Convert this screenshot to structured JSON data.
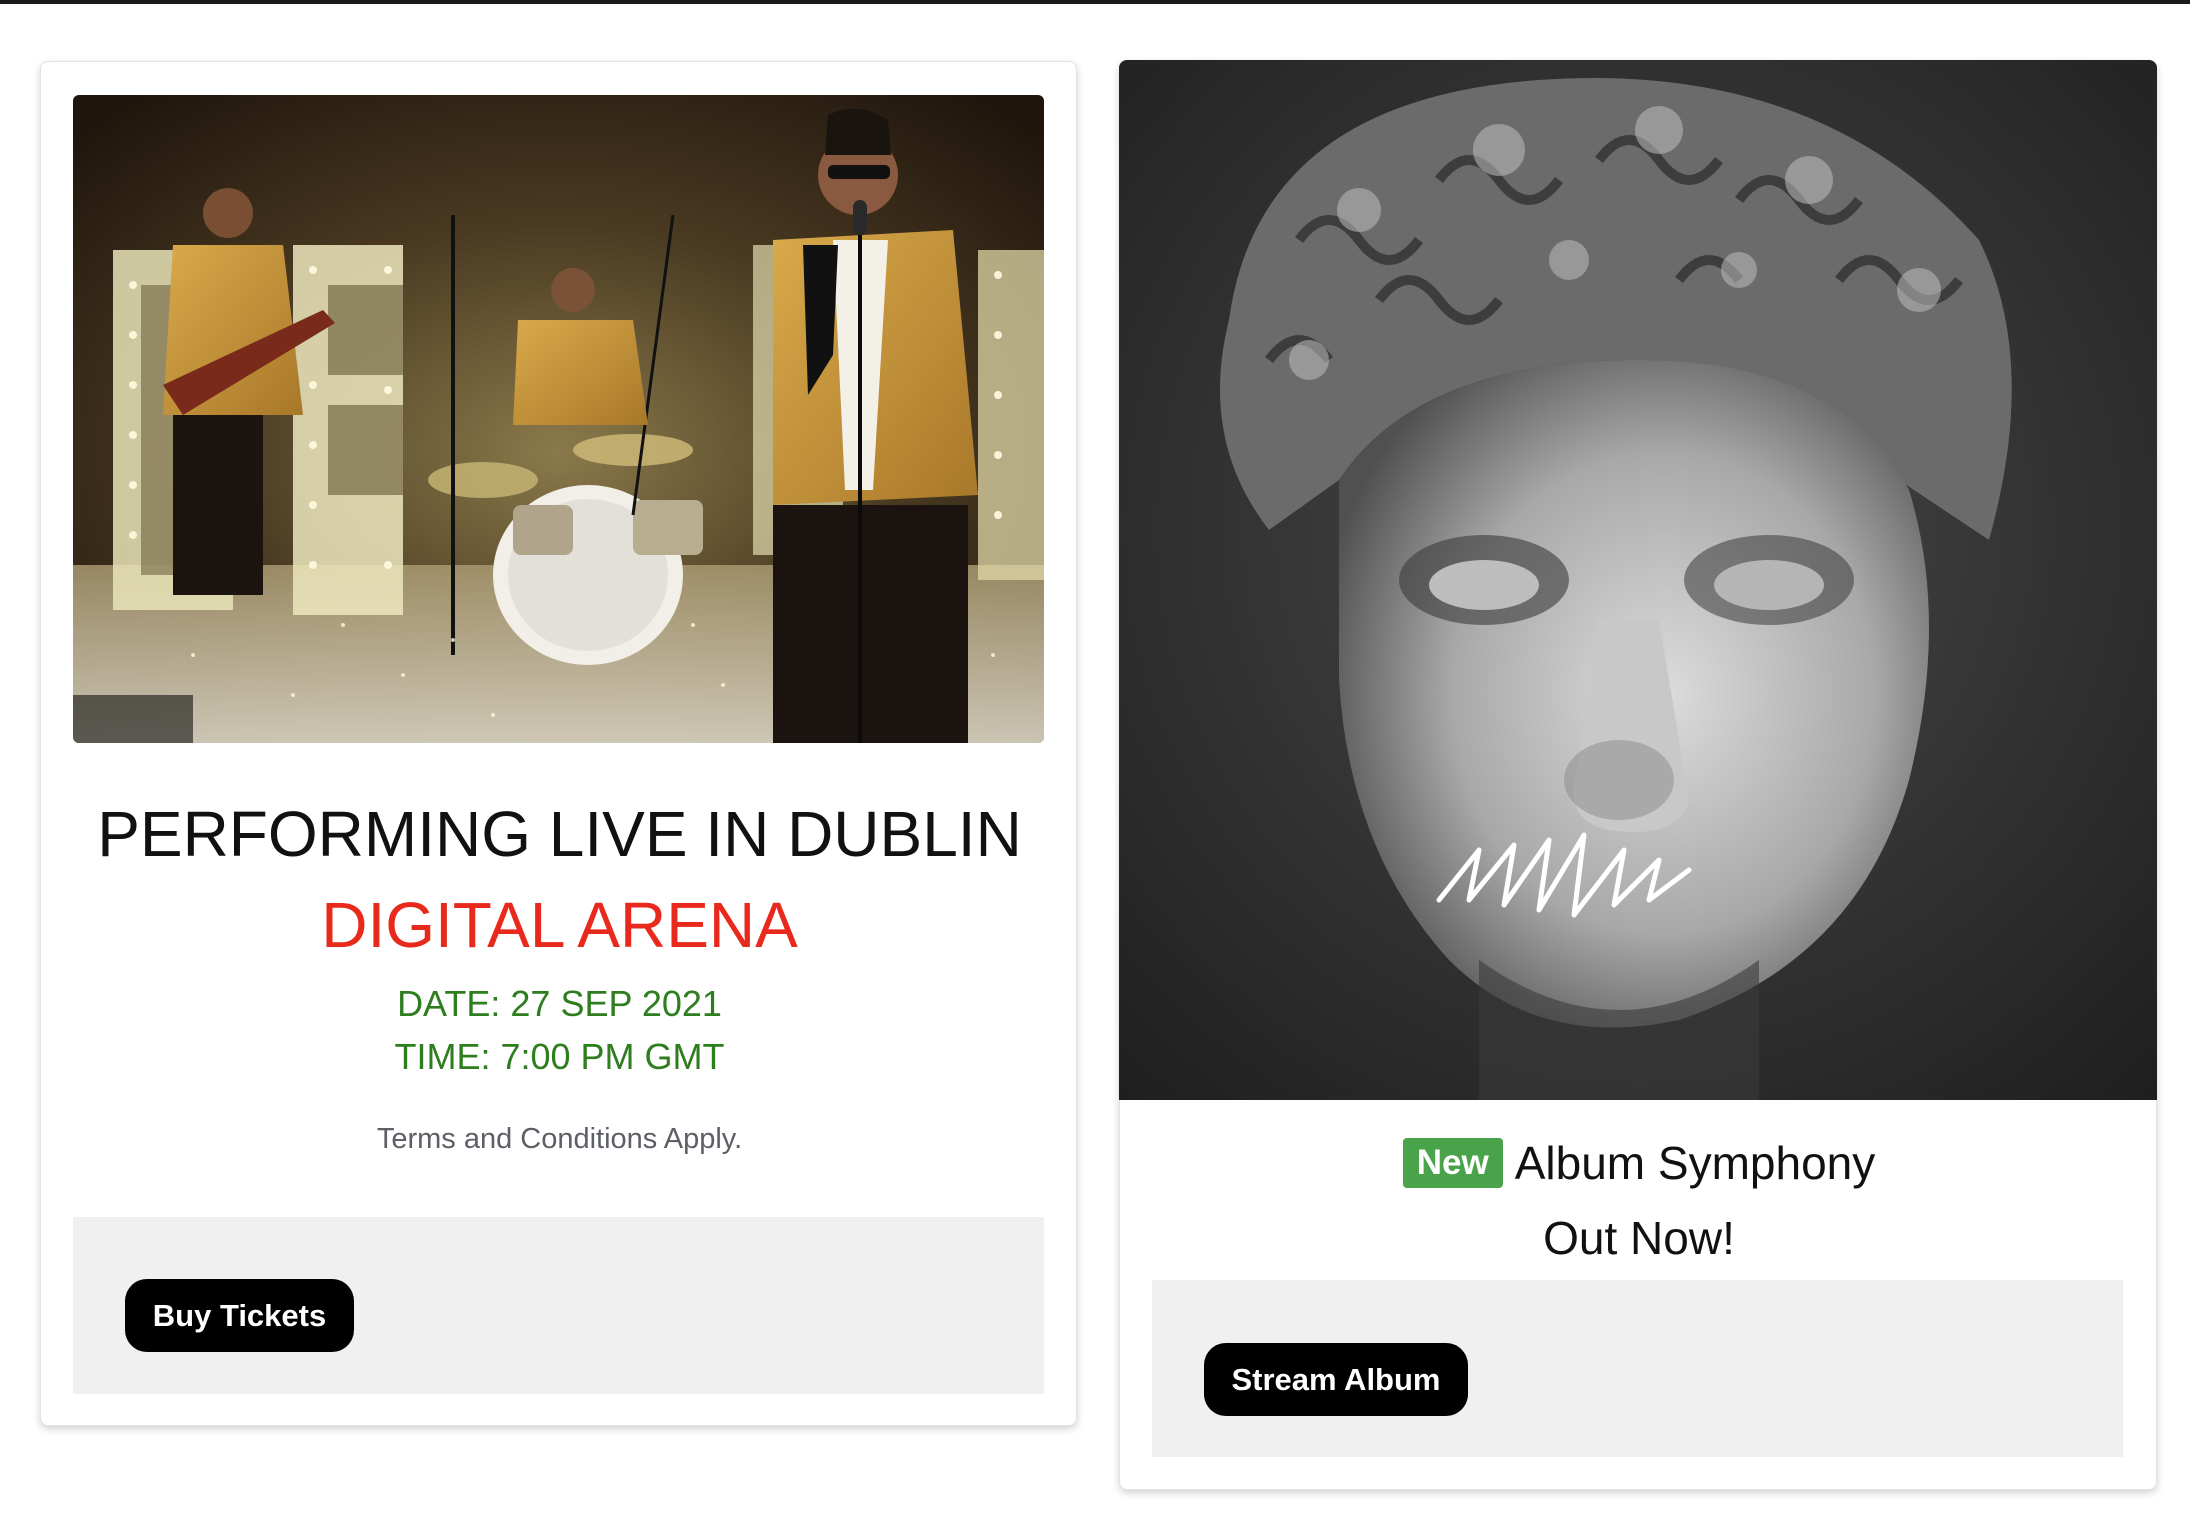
{
  "concert": {
    "title": "PERFORMING LIVE IN DUBLIN",
    "venue": "DIGITAL ARENA",
    "date": "DATE: 27 SEP 2021",
    "time": "TIME: 7:00 PM GMT",
    "terms": "Terms and Conditions Apply.",
    "button_label": "Buy Tickets"
  },
  "album": {
    "badge": "New",
    "title": "Album Symphony",
    "subtitle": "Out Now!",
    "button_label": "Stream Album"
  },
  "colors": {
    "venue": "#e8291c",
    "datetime": "#2e7d1e",
    "badge": "#49a34a",
    "button": "#000000"
  }
}
